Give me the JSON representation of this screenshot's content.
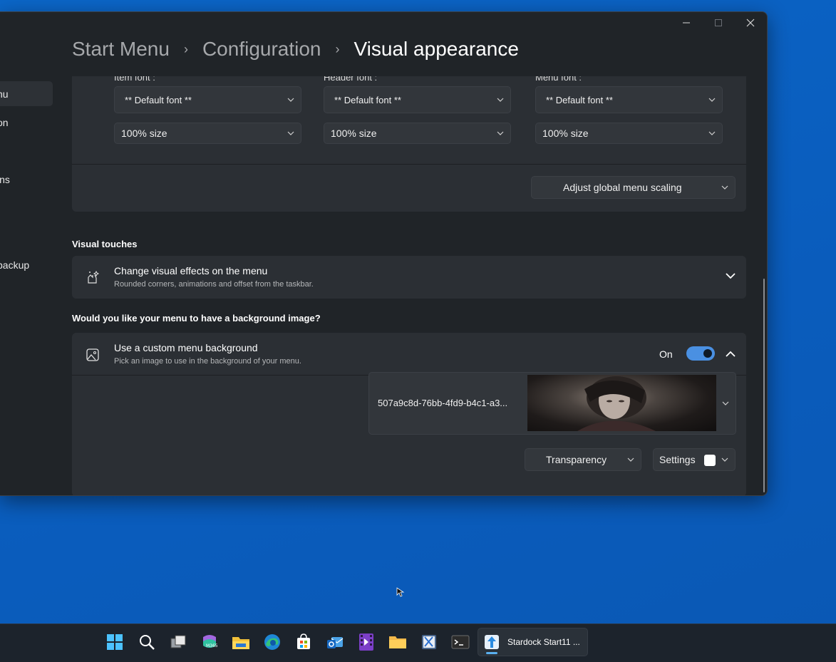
{
  "window": {
    "minimize_label": "─",
    "maximize_label": "☐",
    "close_label": "✕"
  },
  "sidebar": {
    "items": [
      {
        "label": "nu"
      },
      {
        "label": "on"
      },
      {
        "label": "ins"
      },
      {
        "label": "backup"
      }
    ]
  },
  "breadcrumb": {
    "items": [
      "Start Menu",
      "Configuration",
      "Visual appearance"
    ],
    "separator": "›"
  },
  "fonts": {
    "columns": [
      {
        "label": "Item font :",
        "font_value": "** Default font **",
        "size_value": "100% size"
      },
      {
        "label": "Header font :",
        "font_value": "** Default font **",
        "size_value": "100% size"
      },
      {
        "label": "Menu font :",
        "font_value": "** Default font **",
        "size_value": "100% size"
      }
    ],
    "scaling_button": "Adjust global menu scaling"
  },
  "visual_touches": {
    "section_title": "Visual touches",
    "title": "Change visual effects on the menu",
    "subtitle": "Rounded corners, animations and offset from the taskbar."
  },
  "background": {
    "section_title": "Would you like your menu to have a background image?",
    "title": "Use a custom menu background",
    "subtitle": "Pick an image to use in the background of your menu.",
    "toggle_label": "On",
    "toggle_on": true,
    "image_name": "507a9c8d-76bb-4fd9-b4c1-a3...",
    "transparency_label": "Transparency",
    "settings_label": "Settings"
  },
  "taskbar": {
    "icons": [
      "start-icon",
      "search-icon",
      "task-view-icon",
      "m365-icon",
      "file-explorer-icon",
      "edge-icon",
      "store-icon",
      "outlook-icon",
      "clipchamp-icon",
      "folder-icon",
      "snipping-icon",
      "terminal-icon"
    ],
    "active_app_label": "Stardock Start11 ..."
  },
  "colors": {
    "accent": "#4a90e2",
    "desktop": "#0a5fc0",
    "window_bg": "#202428",
    "card_bg": "#2b2f34"
  }
}
